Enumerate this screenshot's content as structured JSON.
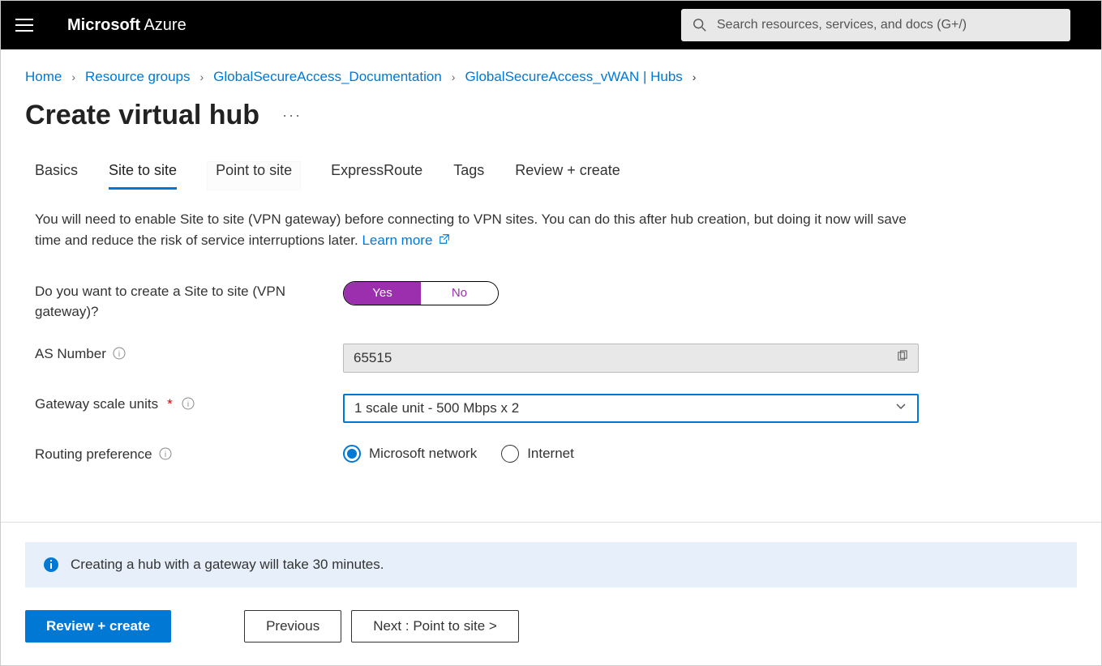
{
  "brand": {
    "ms": "Microsoft",
    "az": " Azure"
  },
  "search": {
    "placeholder": "Search resources, services, and docs (G+/)"
  },
  "breadcrumb": {
    "home": "Home",
    "rg": "Resource groups",
    "doc": "GlobalSecureAccess_Documentation",
    "vwan": "GlobalSecureAccess_vWAN | Hubs"
  },
  "page": {
    "title": "Create virtual hub",
    "ellipsis": "···"
  },
  "tabs": {
    "basics": "Basics",
    "site": "Site to site",
    "point": "Point to site",
    "express": "ExpressRoute",
    "tags": "Tags",
    "review": "Review + create"
  },
  "desc": {
    "text": "You will need to enable Site to site (VPN gateway) before connecting to VPN sites. You can do this after hub creation, but doing it now will save time and reduce the risk of service interruptions later.  ",
    "learn": "Learn more"
  },
  "form": {
    "create_label": "Do you want to create a Site to site (VPN gateway)?",
    "yes": "Yes",
    "no": "No",
    "as_label": "AS Number",
    "as_value": "65515",
    "scale_label": "Gateway scale units",
    "scale_value": "1 scale unit - 500 Mbps x 2",
    "routing_label": "Routing preference",
    "routing_opt1": "Microsoft network",
    "routing_opt2": "Internet"
  },
  "banner": {
    "text": "Creating a hub with a gateway will take 30 minutes."
  },
  "buttons": {
    "review": "Review + create",
    "previous": "Previous",
    "next": "Next : Point to site >"
  }
}
